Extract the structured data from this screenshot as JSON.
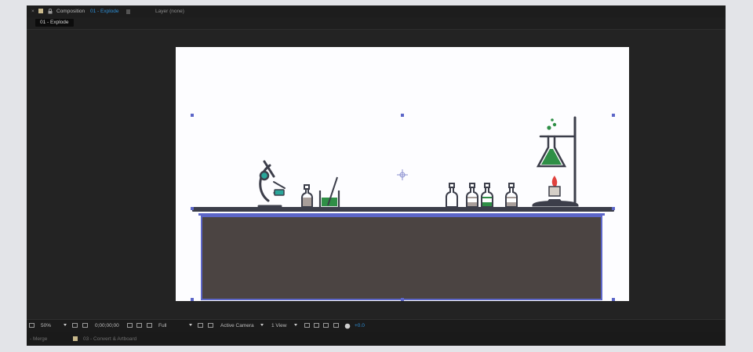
{
  "title_bar": {
    "close_glyph": "×",
    "composition_word": "Composition",
    "composition_name": "01 - Explode",
    "layer_text": "Layer (none)"
  },
  "tabs": [
    {
      "label": "01 - Explode",
      "active": true
    }
  ],
  "status_bar": {
    "zoom": "50%",
    "timecode": "0;00;00;00",
    "resolution": "Full",
    "camera": "Active Camera",
    "views": "1 View",
    "exposure": "+0.0"
  },
  "bottom_bar": {
    "left_text": "- Merge",
    "layer_label": "03 - Convert & Artboard"
  },
  "colors": {
    "accent": "#2e8fd6",
    "table": "#4b4442",
    "outline": "#3c3e4a",
    "selection": "#5c66c8",
    "liquid_green": "#2f8f46",
    "flame_red": "#e0413d",
    "teal": "#2aa69a"
  },
  "icons": [
    "close-icon",
    "composition-color-swatch",
    "lock-icon",
    "panel-menu-icon",
    "comp-region-icon",
    "zoom-dropdown-icon",
    "snapshot-icon",
    "transparency-grid-icon",
    "region-of-interest-icon",
    "camera-icon",
    "color-channel-icon",
    "resolution-dropdown-icon",
    "fast-preview-icon",
    "pixel-aspect-icon",
    "view-layout-dropdown-icon",
    "toggle-mask-icon",
    "reset-exposure-icon",
    "flowchart-icon",
    "exposure-icon",
    "microscope-icon",
    "bottle-icon",
    "beaker-icon",
    "flask-stand-icon",
    "burner-icon"
  ]
}
